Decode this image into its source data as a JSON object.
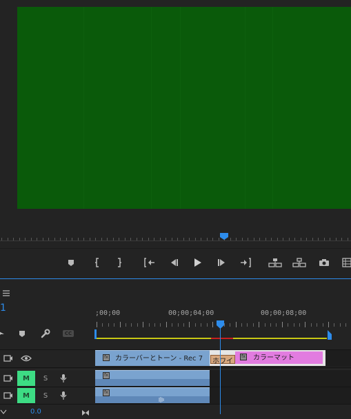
{
  "program_monitor": {
    "viewer_color": "#0a5a0a"
  },
  "transport": {
    "buttons": [
      "add-marker",
      "mark-in",
      "mark-out",
      "go-to-in",
      "step-back",
      "play",
      "step-forward",
      "go-to-out",
      "lift",
      "extract",
      "export-frame",
      "button-editor"
    ]
  },
  "timeline": {
    "sequence_number": "1",
    "timecodes": [
      ";00;00",
      "00;00;04;00",
      "00;00;08;00"
    ],
    "tracks": {
      "v1": {
        "toggle": "eye"
      },
      "a1": {
        "mute": "M",
        "solo": "S"
      },
      "a2": {
        "mute": "M",
        "solo": "S"
      }
    },
    "clips": {
      "v1_bars": {
        "name": "カラーバーとトーン - Rec 7",
        "fx": "fx",
        "color": "#7aa3cf"
      },
      "v1_transition": {
        "name": "ホワイ",
        "color": "#d7a77e"
      },
      "v1_matte": {
        "name": "カラーマット",
        "fx": "fx",
        "color": "#e27ce0"
      },
      "a1_audio": {
        "fx": "fx",
        "color": "#7aa3cf"
      },
      "a2_audio": {
        "fx": "fx",
        "color": "#7aa3cf"
      }
    },
    "master_volume": "0.0",
    "accent_color": "#2d8ceb",
    "workarea_color": "#c8c814"
  }
}
